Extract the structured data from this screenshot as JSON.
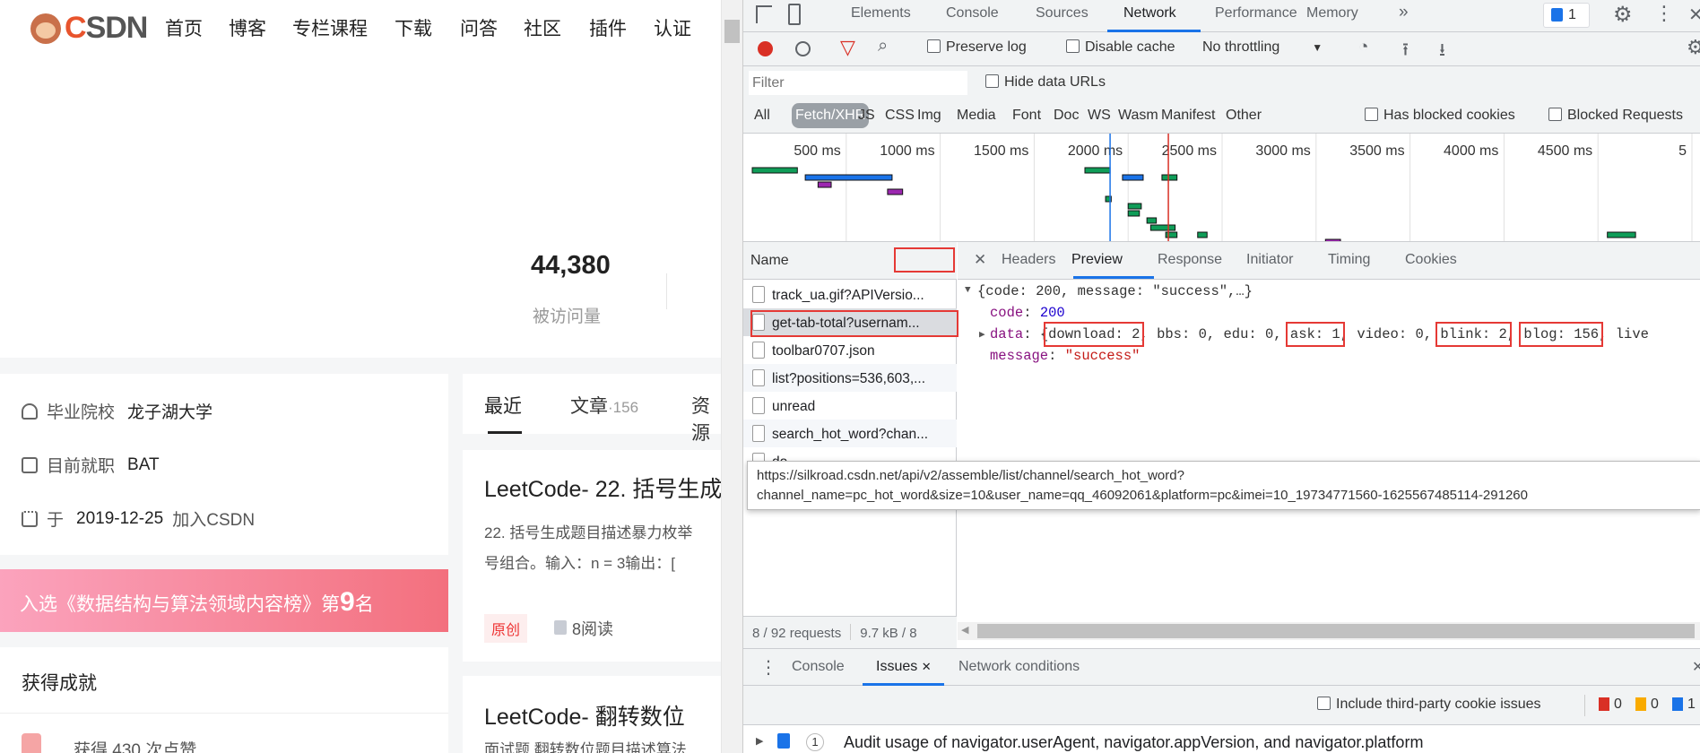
{
  "site": {
    "logo": "CSDN",
    "nav": [
      "首页",
      "博客",
      "专栏课程",
      "下载",
      "问答",
      "社区",
      "插件",
      "认证"
    ]
  },
  "profile": {
    "visits": "44,380",
    "visits_label": "被访问量"
  },
  "info": [
    {
      "label": "毕业院校",
      "value": "龙子湖大学",
      "icon": "school-icon"
    },
    {
      "label": "目前就职",
      "value": "BAT",
      "icon": "briefcase-icon"
    },
    {
      "label": "于",
      "value": "2019-12-25",
      "suffix": "加入CSDN",
      "icon": "cake-icon"
    }
  ],
  "banner": {
    "pre": "入选《数据结构与算法领域内容榜》第",
    "rank": "9",
    "post": "名"
  },
  "achievements": {
    "title": "获得成就",
    "item": "获得 430 次点赞"
  },
  "content_tabs": {
    "recent": "最近",
    "articles": "文章",
    "articles_count": "·156",
    "resources": "资源"
  },
  "articles": [
    {
      "title": "LeetCode- 22. 括号生成",
      "desc1": "22. 括号生成题目描述暴力枚举",
      "desc2": "号组合。输入：n = 3输出：[",
      "tag": "原创",
      "reads": "8阅读"
    },
    {
      "title": "LeetCode- 翻转数位",
      "desc1": "面试题 翻转数位题目描述算法"
    }
  ],
  "devtools": {
    "tabs": [
      "Elements",
      "Console",
      "Sources",
      "Network",
      "Performance",
      "Memory",
      "»"
    ],
    "active_tab": "Network",
    "issues_badge": "1",
    "toolbar": {
      "preserve_log": "Preserve log",
      "disable_cache": "Disable cache",
      "throttling": "No throttling"
    },
    "filter": {
      "placeholder": "Filter",
      "hide_data_urls": "Hide data URLs"
    },
    "types": [
      "All",
      "Fetch/XHR",
      "JS",
      "CSS",
      "Img",
      "Media",
      "Font",
      "Doc",
      "WS",
      "Wasm",
      "Manifest",
      "Other"
    ],
    "active_type": "Fetch/XHR",
    "has_blocked_cookies": "Has blocked cookies",
    "blocked_requests": "Blocked Requests",
    "timeline": {
      "ticks": [
        "500 ms",
        "1000 ms",
        "1500 ms",
        "2000 ms",
        "2500 ms",
        "3000 ms",
        "3500 ms",
        "4000 ms",
        "4500 ms",
        "5"
      ],
      "dom_content_loaded_ms": 1904,
      "load_ms": 2214,
      "bars": [
        [
          0,
          240,
          0,
          "#0f9d58"
        ],
        [
          282,
          744,
          1,
          "#1a73e8"
        ],
        [
          350,
          420,
          2,
          "#9c27b0"
        ],
        [
          720,
          800,
          3,
          "#9c27b0"
        ],
        [
          1770,
          1904,
          0,
          "#0f9d58"
        ],
        [
          1970,
          2080,
          1,
          "#1a73e8"
        ],
        [
          2180,
          2260,
          1,
          "#0f9d58"
        ],
        [
          1880,
          1910,
          4,
          "#0f9d58"
        ],
        [
          2000,
          2070,
          5,
          "#0f9d58"
        ],
        [
          2000,
          2060,
          6,
          "#0f9d58"
        ],
        [
          2100,
          2150,
          7,
          "#0f9d58"
        ],
        [
          2120,
          2250,
          8,
          "#0f9d58"
        ],
        [
          2200,
          2260,
          9,
          "#0f9d58"
        ],
        [
          2370,
          2420,
          9,
          "#0f9d58"
        ],
        [
          3050,
          3130,
          10,
          "#9c27b0"
        ],
        [
          3130,
          3200,
          11,
          "#0f9d58"
        ],
        [
          4550,
          4700,
          9,
          "#0f9d58"
        ]
      ]
    },
    "name_header": "Name",
    "requests": [
      "track_ua.gif?APIVersio...",
      "get-tab-total?usernam...",
      "toolbar0707.json",
      "list?positions=536,603,...",
      "unread",
      "search_hot_word?chan...",
      "do"
    ],
    "selected_request": 1,
    "detail_tabs": [
      "Headers",
      "Preview",
      "Response",
      "Initiator",
      "Timing",
      "Cookies"
    ],
    "active_detail": "Preview",
    "preview": {
      "summary": "{code: 200, message: \"success\",…}",
      "code_key": "code",
      "code_val": "200",
      "data_key": "data",
      "data_items": [
        "download: 2",
        "bbs: 0",
        "edu: 0",
        "ask: 1",
        "video: 0",
        "blink: 2",
        "blog: 156",
        "live"
      ],
      "message_key": "message",
      "message_val": "\"success\""
    },
    "tooltip": [
      "https://silkroad.csdn.net/api/v2/assemble/list/channel/search_hot_word?",
      "channel_name=pc_hot_word&size=10&user_name=qq_46092061&platform=pc&imei=10_19734771560-1625567485114-291260"
    ],
    "status": {
      "requests": "8 / 92 requests",
      "size": "9.7 kB / 8"
    },
    "drawer_tabs": [
      "Console",
      "Issues",
      "Network conditions"
    ],
    "active_drawer": "Issues",
    "issues": {
      "third_party": "Include third-party cookie issues",
      "errors": "0",
      "warnings": "0",
      "info": "1",
      "issue_count": "1",
      "issue_text": "Audit usage of navigator.userAgent, navigator.appVersion, and navigator.platform"
    },
    "colors": {
      "accent": "#1a73e8",
      "record": "#d93025",
      "annotation": "#e53935"
    }
  }
}
